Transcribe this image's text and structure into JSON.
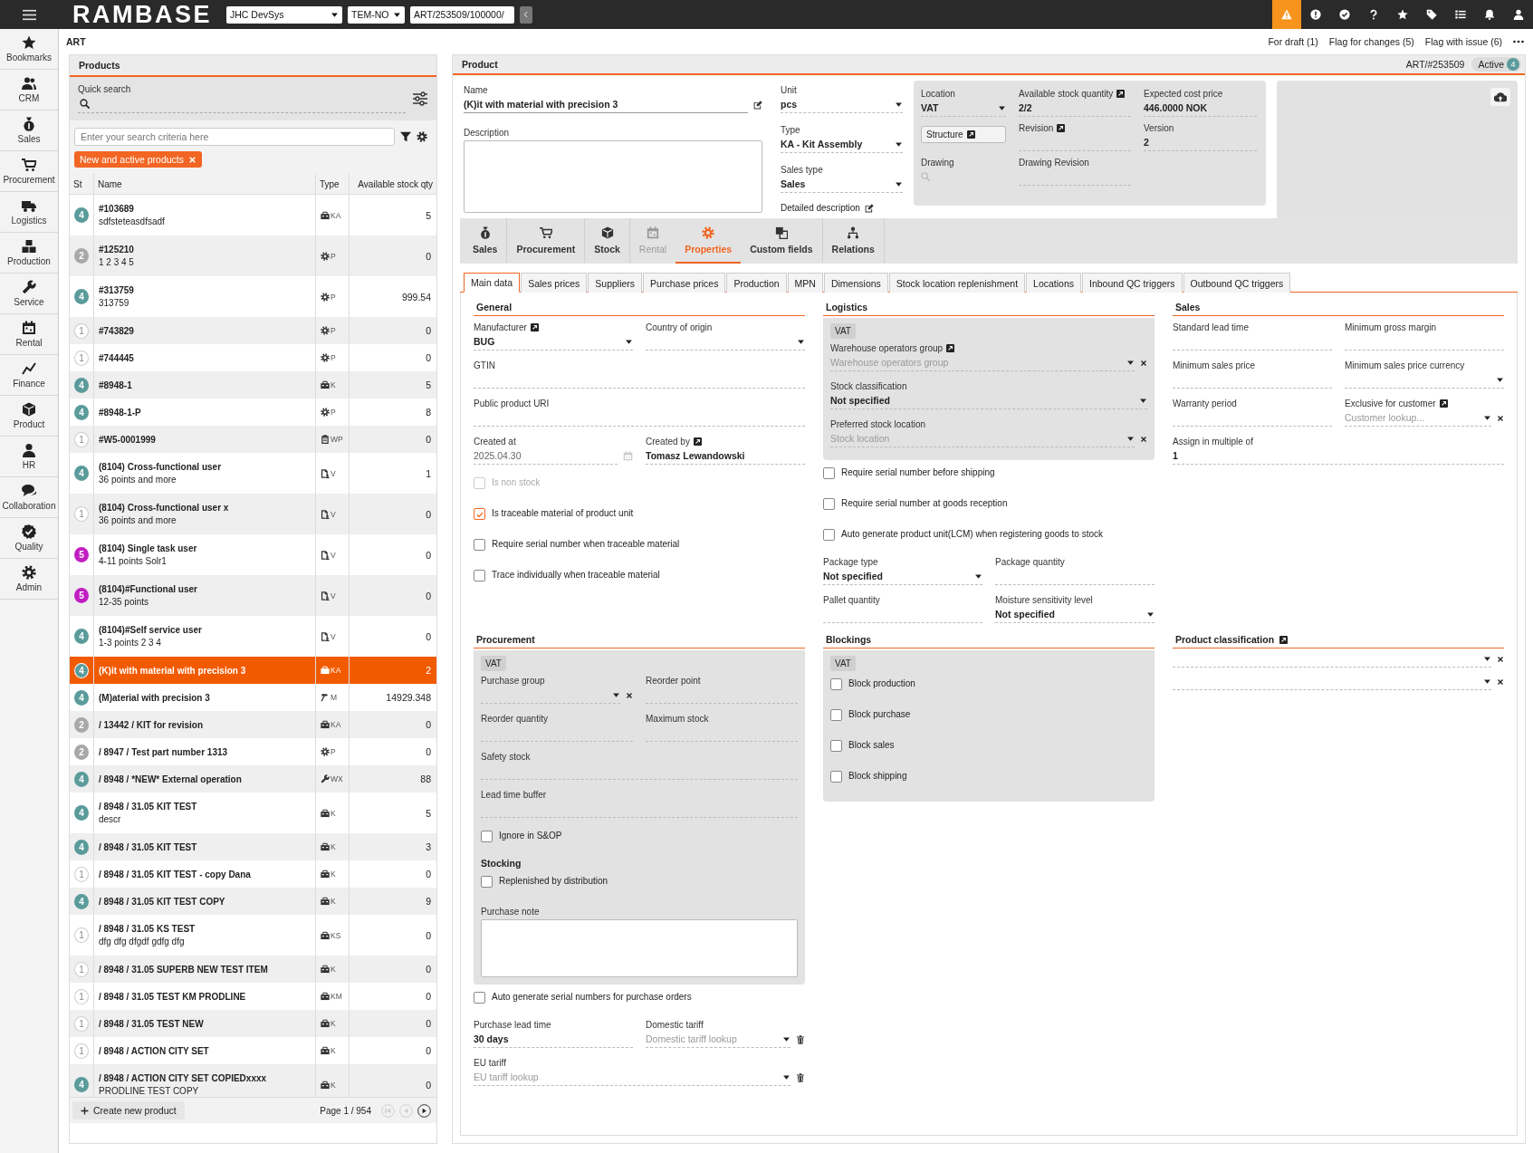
{
  "topbar": {
    "logo": "RAMBASE",
    "company": "JHC DevSys",
    "region": "TEM-NO",
    "path": "ART/253509/100000/"
  },
  "nav": [
    {
      "label": "Bookmarks"
    },
    {
      "label": "CRM"
    },
    {
      "label": "Sales"
    },
    {
      "label": "Procurement"
    },
    {
      "label": "Logistics"
    },
    {
      "label": "Production"
    },
    {
      "label": "Service"
    },
    {
      "label": "Rental"
    },
    {
      "label": "Finance"
    },
    {
      "label": "Product"
    },
    {
      "label": "HR"
    },
    {
      "label": "Collaboration"
    },
    {
      "label": "Quality"
    },
    {
      "label": "Admin"
    }
  ],
  "breadcrumb": "ART",
  "flags": [
    "For draft (1)",
    "Flag for changes (5)",
    "Flag with issue (6)"
  ],
  "products": {
    "title": "Products",
    "quick_search": "Quick search",
    "search": {
      "placeholder": "Enter your search criteria here"
    },
    "filter_chip": "New and active products",
    "columns": [
      "St",
      "Name",
      "Type",
      "Available stock qty"
    ],
    "rows": [
      {
        "status": "4",
        "color": "#5b9b9b",
        "name": "#103689",
        "description": "sdfsteteasdfsadf",
        "type": {
          "kind": "kit",
          "code": "KA"
        },
        "qty": "5",
        "selected": false
      },
      {
        "status": "2",
        "color": "#a8a8a8",
        "name": "#125210",
        "description": "1 2 3 4 5",
        "type": {
          "kind": "part",
          "code": "P"
        },
        "qty": "0",
        "selected": false
      },
      {
        "status": "4",
        "color": "#5b9b9b",
        "name": "#313759",
        "description": "313759",
        "type": {
          "kind": "part",
          "code": "P"
        },
        "qty": "999.54",
        "selected": false
      },
      {
        "status": "1",
        "color": "#ffffff",
        "name": "#743829",
        "type": {
          "kind": "part",
          "code": "P"
        },
        "qty": "0",
        "selected": false
      },
      {
        "status": "1",
        "color": "#ffffff",
        "name": "#744445",
        "type": {
          "kind": "part",
          "code": "P"
        },
        "qty": "0",
        "selected": false
      },
      {
        "status": "4",
        "color": "#5b9b9b",
        "name": "#8948-1",
        "type": {
          "kind": "kit",
          "code": "K"
        },
        "qty": "5",
        "selected": false
      },
      {
        "status": "4",
        "color": "#5b9b9b",
        "name": "#8948-1-P",
        "type": {
          "kind": "part",
          "code": "P"
        },
        "qty": "8",
        "selected": false
      },
      {
        "status": "1",
        "color": "#ffffff",
        "name": "#W5-0001999",
        "type": {
          "kind": "plan",
          "code": "WP"
        },
        "qty": "0",
        "selected": false
      },
      {
        "status": "4",
        "color": "#5b9b9b",
        "name": "(8104) Cross-functional user",
        "description": "36 points and more",
        "type": {
          "kind": "doc",
          "code": "V"
        },
        "qty": "1",
        "selected": false
      },
      {
        "status": "1",
        "color": "#ffffff",
        "name": "(8104) Cross-functional user x",
        "description": "36 points and more",
        "type": {
          "kind": "doc",
          "code": "V"
        },
        "qty": "0",
        "selected": false
      },
      {
        "status": "5",
        "color": "#c21fc2",
        "name": "(8104) Single task user",
        "description": "4-11 points Solr1",
        "type": {
          "kind": "doc",
          "code": "V"
        },
        "qty": "0",
        "selected": false
      },
      {
        "status": "5",
        "color": "#c21fc2",
        "name": "(8104)#Functional user",
        "description": "12-35 points",
        "type": {
          "kind": "doc",
          "code": "V"
        },
        "qty": "0",
        "selected": false
      },
      {
        "status": "4",
        "color": "#5b9b9b",
        "name": "(8104)#Self service user",
        "description": "1-3 points 2 3 4",
        "type": {
          "kind": "doc",
          "code": "V"
        },
        "qty": "0",
        "selected": false
      },
      {
        "status": "4",
        "color": "#5b9b9b",
        "name": "(K)it with material with precision 3",
        "type": {
          "kind": "kit",
          "code": "KA"
        },
        "qty": "2",
        "selected": true
      },
      {
        "status": "4",
        "color": "#5b9b9b",
        "name": "(M)aterial with precision 3",
        "type": {
          "kind": "material",
          "code": "M"
        },
        "qty": "14929.348",
        "selected": false
      },
      {
        "status": "2",
        "color": "#a8a8a8",
        "name": "/ 13442 / KIT for revision",
        "type": {
          "kind": "kit",
          "code": "KA"
        },
        "qty": "0",
        "selected": false
      },
      {
        "status": "2",
        "color": "#a8a8a8",
        "name": "/ 8947 / Test part number 1313",
        "type": {
          "kind": "part",
          "code": "P"
        },
        "qty": "0",
        "selected": false
      },
      {
        "status": "4",
        "color": "#5b9b9b",
        "name": "/ 8948 / *NEW* External operation",
        "type": {
          "kind": "operation",
          "code": "WX"
        },
        "qty": "88",
        "selected": false
      },
      {
        "status": "4",
        "color": "#5b9b9b",
        "name": "/ 8948 / 31.05 KIT TEST",
        "description": "descr",
        "type": {
          "kind": "kit",
          "code": "K"
        },
        "qty": "5",
        "selected": false
      },
      {
        "status": "4",
        "color": "#5b9b9b",
        "name": "/ 8948 / 31.05 KIT TEST",
        "type": {
          "kind": "kit",
          "code": "K"
        },
        "qty": "3",
        "selected": false
      },
      {
        "status": "1",
        "color": "#ffffff",
        "name": "/ 8948 / 31.05 KIT TEST - copy Dana",
        "type": {
          "kind": "kit",
          "code": "K"
        },
        "qty": "0",
        "selected": false
      },
      {
        "status": "4",
        "color": "#5b9b9b",
        "name": "/ 8948 / 31.05 KIT TEST COPY",
        "type": {
          "kind": "kit",
          "code": "K"
        },
        "qty": "9",
        "selected": false
      },
      {
        "status": "1",
        "color": "#ffffff",
        "name": "/ 8948 / 31.05 KS TEST",
        "description": "dfg dfg dfgdf gdfg dfg",
        "type": {
          "kind": "kit",
          "code": "KS"
        },
        "qty": "0",
        "selected": false
      },
      {
        "status": "1",
        "color": "#ffffff",
        "name": "/ 8948 / 31.05 SUPERB NEW TEST ITEM",
        "type": {
          "kind": "kit",
          "code": "K"
        },
        "qty": "0",
        "selected": false
      },
      {
        "status": "1",
        "color": "#ffffff",
        "name": "/ 8948 / 31.05 TEST KM PRODLINE",
        "type": {
          "kind": "kit",
          "code": "KM"
        },
        "qty": "0",
        "selected": false
      },
      {
        "status": "1",
        "color": "#ffffff",
        "name": "/ 8948 / 31.05 TEST NEW",
        "type": {
          "kind": "kit",
          "code": "K"
        },
        "qty": "0",
        "selected": false
      },
      {
        "status": "1",
        "color": "#ffffff",
        "name": "/ 8948 / ACTION CITY SET",
        "type": {
          "kind": "kit",
          "code": "K"
        },
        "qty": "0",
        "selected": false
      },
      {
        "status": "4",
        "color": "#5b9b9b",
        "name": "/ 8948 / ACTION CITY SET COPIEDxxxx",
        "description": "PRODLINE TEST COPY",
        "type": {
          "kind": "kit",
          "code": "K"
        },
        "qty": "0",
        "selected": false
      }
    ],
    "create_button": "Create new product",
    "page": "Page 1 / 954",
    "pager": [
      {
        "disabled": true
      },
      {
        "disabled": true
      },
      {
        "disabled": false
      }
    ]
  },
  "product": {
    "title": "Product",
    "number": "ART/#253509",
    "status": "Active",
    "status_count": "4",
    "name": {
      "label": "Name",
      "value": "(K)it with material with precision 3",
      "kind": "text",
      "edit": true
    },
    "description": {
      "label": "Description"
    },
    "unit": {
      "label": "Unit",
      "value": "pcs",
      "kind": "select"
    },
    "type": {
      "label": "Type",
      "value": "KA - Kit Assembly",
      "kind": "select"
    },
    "sales_type": {
      "label": "Sales type",
      "value": "Sales",
      "kind": "select"
    },
    "detailed_description": "Detailed description",
    "location": {
      "label": "Location",
      "value": "VAT",
      "kind": "select"
    },
    "available_stock": {
      "label": "Available stock quantity",
      "value": "2/2",
      "kind": "text",
      "link": true
    },
    "expected_cost": {
      "label": "Expected cost price",
      "value": "446.0000 NOK",
      "kind": "text"
    },
    "structure_button": "Structure",
    "revision": {
      "label": "Revision",
      "kind": "text",
      "link": true
    },
    "version": {
      "label": "Version",
      "value": "2",
      "kind": "text"
    },
    "drawing": {
      "label": "Drawing",
      "kind": "search"
    },
    "drawing_revision": {
      "label": "Drawing Revision",
      "kind": "text"
    },
    "module_tabs": [
      {
        "label": "Sales",
        "selected": false,
        "disabled": false
      },
      {
        "label": "Procurement",
        "selected": false,
        "disabled": false
      },
      {
        "label": "Stock",
        "selected": false,
        "disabled": false
      },
      {
        "label": "Rental",
        "selected": false,
        "disabled": true
      },
      {
        "label": "Properties",
        "selected": true,
        "disabled": false
      },
      {
        "label": "Custom fields",
        "selected": false,
        "disabled": false
      },
      {
        "label": "Relations",
        "selected": false,
        "disabled": false
      }
    ],
    "sub_tabs": [
      {
        "label": "Main data",
        "selected": true
      },
      {
        "label": "Sales prices",
        "selected": false
      },
      {
        "label": "Suppliers",
        "selected": false
      },
      {
        "label": "Purchase prices",
        "selected": false
      },
      {
        "label": "Production",
        "selected": false
      },
      {
        "label": "MPN",
        "selected": false
      },
      {
        "label": "Dimensions",
        "selected": false
      },
      {
        "label": "Stock location replenishment",
        "selected": false
      },
      {
        "label": "Locations",
        "selected": false
      },
      {
        "label": "Inbound QC triggers",
        "selected": false
      },
      {
        "label": "Outbound QC triggers",
        "selected": false
      }
    ],
    "sections": [
      {
        "title": "General",
        "items": [
          {
            "kind": "row",
            "fields": [
              {
                "label": "Manufacturer",
                "link": true,
                "kind": "select",
                "value": "BUG"
              },
              {
                "label": "Country of origin",
                "kind": "select"
              }
            ]
          },
          {
            "kind": "row",
            "fields": [
              {
                "label": "GTIN",
                "kind": "text"
              }
            ]
          },
          {
            "kind": "row",
            "fields": [
              {
                "label": "Public product URI",
                "kind": "text"
              }
            ]
          },
          {
            "kind": "row",
            "fields": [
              {
                "label": "Created at",
                "kind": "date",
                "value": "2025.04.30"
              },
              {
                "label": "Created by",
                "link": true,
                "kind": "text",
                "value": "Tomasz Lewandowski"
              }
            ]
          },
          {
            "kind": "checkbox",
            "label": "Is non stock",
            "checked": false,
            "disabled": true
          },
          {
            "kind": "checkbox",
            "label": "Is traceable material of product unit",
            "checked": true,
            "disabled": false
          },
          {
            "kind": "checkbox",
            "label": "Require serial number when traceable material",
            "checked": false,
            "disabled": false
          },
          {
            "kind": "checkbox",
            "label": "Trace individually when traceable material",
            "checked": false,
            "disabled": false
          }
        ]
      },
      {
        "title": "Logistics",
        "panel": {
          "tag": "VAT",
          "items": [
            {
              "kind": "row",
              "fields": [
                {
                  "label": "Warehouse operators group",
                  "link": true,
                  "kind": "select",
                  "placeholder": "Warehouse operators group",
                  "clear": true
                }
              ]
            },
            {
              "kind": "row",
              "fields": [
                {
                  "label": "Stock classification",
                  "kind": "select",
                  "value": "Not specified"
                }
              ]
            },
            {
              "kind": "row",
              "fields": [
                {
                  "label": "Preferred stock location",
                  "kind": "select",
                  "placeholder": "Stock location",
                  "clear": true
                }
              ]
            }
          ]
        },
        "items": [
          {
            "kind": "checkbox",
            "label": "Require serial number before shipping",
            "checked": false,
            "disabled": false
          },
          {
            "kind": "checkbox",
            "label": "Require serial number at goods reception",
            "checked": false,
            "disabled": false
          },
          {
            "kind": "checkbox",
            "label": "Auto generate product unit(LCM) when registering goods to stock",
            "checked": false,
            "disabled": false
          },
          {
            "kind": "row",
            "fields": [
              {
                "label": "Package type",
                "kind": "select",
                "value": "Not specified"
              },
              {
                "label": "Package quantity",
                "kind": "text"
              }
            ]
          },
          {
            "kind": "row",
            "fields": [
              {
                "label": "Pallet quantity",
                "kind": "text"
              },
              {
                "label": "Moisture sensitivity level",
                "kind": "select",
                "value": "Not specified"
              }
            ]
          }
        ]
      },
      {
        "title": "Sales",
        "items": [
          {
            "kind": "row",
            "fields": [
              {
                "label": "Standard lead time",
                "kind": "text"
              },
              {
                "label": "Minimum gross margin",
                "kind": "text"
              }
            ]
          },
          {
            "kind": "row",
            "fields": [
              {
                "label": "Minimum sales price",
                "kind": "text"
              },
              {
                "label": "Minimum sales price currency",
                "kind": "select"
              }
            ]
          },
          {
            "kind": "row",
            "fields": [
              {
                "label": "Warranty period",
                "kind": "text"
              },
              {
                "label": "Exclusive for customer",
                "link": true,
                "kind": "select",
                "placeholder": "Customer lookup...",
                "clear": true
              }
            ]
          },
          {
            "kind": "row",
            "fields": [
              {
                "label": "Assign in multiple of",
                "kind": "text",
                "value": "1"
              }
            ]
          }
        ]
      },
      {
        "title": "Procurement",
        "panel": {
          "tag": "VAT",
          "items": [
            {
              "kind": "row",
              "fields": [
                {
                  "label": "Purchase group",
                  "kind": "select",
                  "clear": true
                },
                {
                  "label": "Reorder point",
                  "kind": "text"
                }
              ]
            },
            {
              "kind": "row",
              "fields": [
                {
                  "label": "Reorder quantity",
                  "kind": "text"
                },
                {
                  "label": "Maximum stock",
                  "kind": "text"
                }
              ]
            },
            {
              "kind": "row",
              "fields": [
                {
                  "label": "Safety stock",
                  "kind": "text"
                }
              ]
            },
            {
              "kind": "row",
              "fields": [
                {
                  "label": "Lead time buffer",
                  "kind": "text"
                }
              ]
            },
            {
              "kind": "checkbox",
              "label": "Ignore in S&OP",
              "checked": false,
              "disabled": false
            },
            {
              "kind": "heading",
              "text": "Stocking"
            },
            {
              "kind": "checkbox",
              "label": "Replenished by distribution",
              "checked": false,
              "disabled": false
            },
            {
              "kind": "note",
              "label": "Purchase note"
            }
          ]
        },
        "items": [
          {
            "kind": "checkbox",
            "label": "Auto generate serial numbers for purchase orders",
            "checked": false,
            "disabled": false
          },
          {
            "kind": "row",
            "fields": [
              {
                "label": "Purchase lead time",
                "kind": "text",
                "value": "30 days"
              },
              {
                "label": "Domestic tariff",
                "kind": "select",
                "placeholder": "Domestic tariff lookup",
                "trash": true
              }
            ]
          },
          {
            "kind": "row",
            "fields": [
              {
                "label": "EU tariff",
                "kind": "select",
                "placeholder": "EU tariff lookup",
                "trash": true
              }
            ]
          }
        ]
      },
      {
        "title": "Blockings",
        "panel": {
          "tag": "VAT",
          "items": [
            {
              "kind": "checkbox",
              "label": "Block production",
              "checked": false,
              "disabled": false
            },
            {
              "kind": "checkbox",
              "label": "Block purchase",
              "checked": false,
              "disabled": false
            },
            {
              "kind": "checkbox",
              "label": "Block sales",
              "checked": false,
              "disabled": false
            },
            {
              "kind": "checkbox",
              "label": "Block shipping",
              "checked": false,
              "disabled": false
            }
          ]
        }
      },
      {
        "title": "Product classification",
        "link": true,
        "items": [
          {
            "kind": "row",
            "fields": [
              {
                "kind": "select",
                "clear": true
              }
            ]
          },
          {
            "kind": "row",
            "fields": [
              {
                "kind": "select",
                "clear": true
              }
            ]
          }
        ]
      }
    ]
  }
}
